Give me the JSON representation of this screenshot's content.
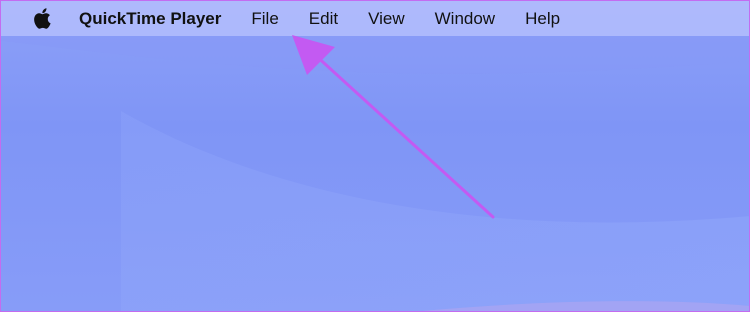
{
  "menubar": {
    "apple_icon": "apple-logo-icon",
    "app_name": "QuickTime Player",
    "items": [
      {
        "label": "File"
      },
      {
        "label": "Edit"
      },
      {
        "label": "View"
      },
      {
        "label": "Window"
      },
      {
        "label": "Help"
      }
    ]
  },
  "annotation": {
    "arrow_color": "#c35af2",
    "arrow_target": "File"
  },
  "colors": {
    "desktop": "#7f95f6",
    "menubar": "#b6c0fc",
    "frame_border": "#c36cf0"
  }
}
